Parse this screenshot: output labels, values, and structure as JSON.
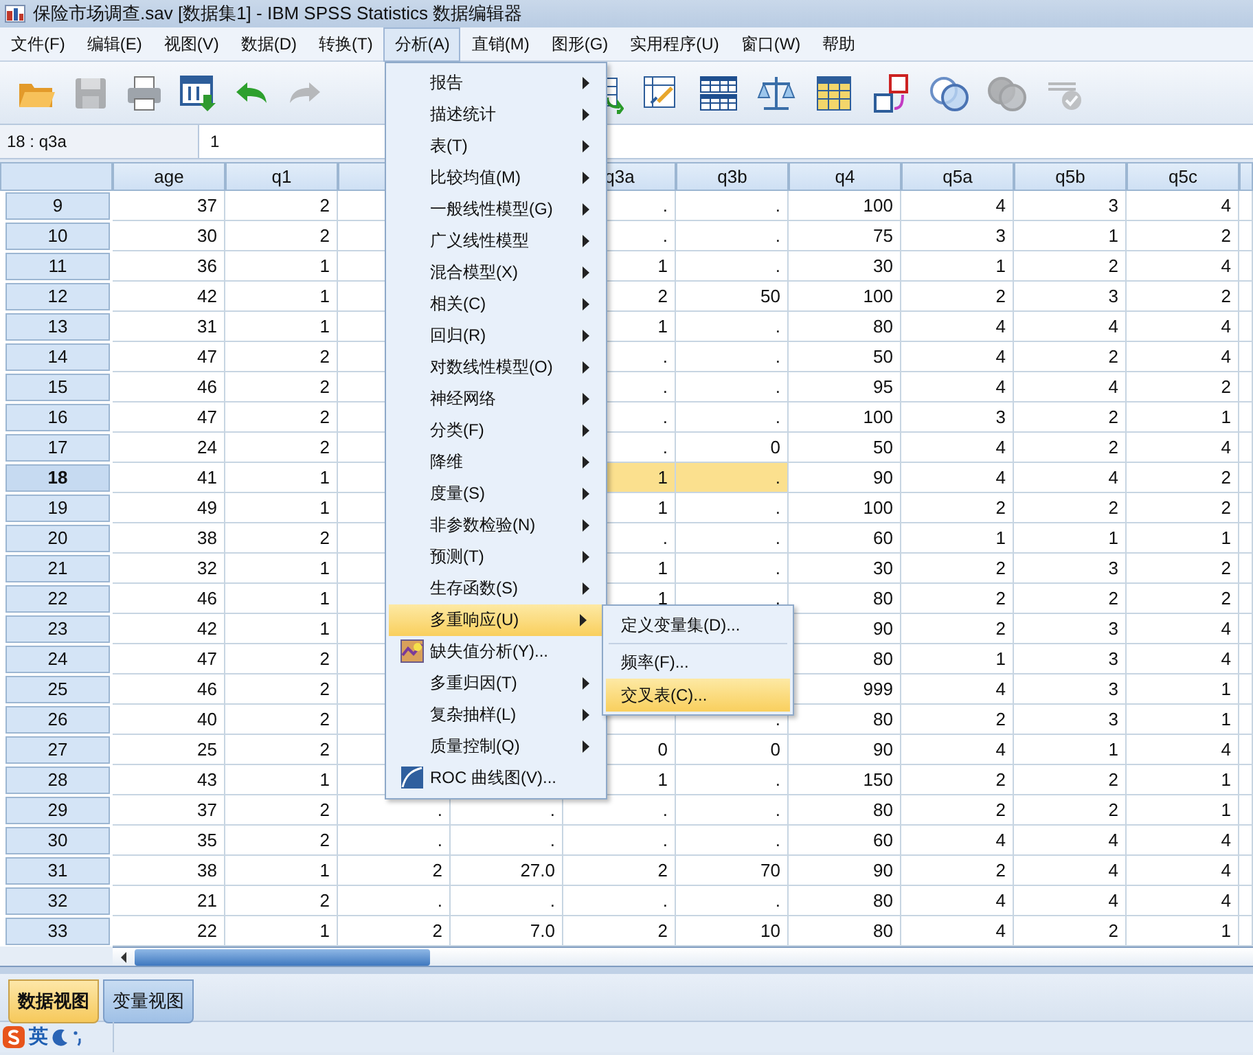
{
  "window": {
    "title": "保险市场调查.sav [数据集1] - IBM SPSS Statistics 数据编辑器"
  },
  "menu_bar": [
    {
      "label": "文件(F)",
      "selected": false
    },
    {
      "label": "编辑(E)",
      "selected": false
    },
    {
      "label": "视图(V)",
      "selected": false
    },
    {
      "label": "数据(D)",
      "selected": false
    },
    {
      "label": "转换(T)",
      "selected": false
    },
    {
      "label": "分析(A)",
      "selected": true
    },
    {
      "label": "直销(M)",
      "selected": false
    },
    {
      "label": "图形(G)",
      "selected": false
    },
    {
      "label": "实用程序(U)",
      "selected": false
    },
    {
      "label": "窗口(W)",
      "selected": false
    },
    {
      "label": "帮助",
      "selected": false
    }
  ],
  "toolbar_left": [
    {
      "kind": "open",
      "disabled": false
    },
    {
      "kind": "save",
      "disabled": true
    },
    {
      "kind": "print",
      "disabled": false
    },
    {
      "kind": "goto",
      "disabled": false
    },
    {
      "kind": "undo",
      "disabled": false
    },
    {
      "kind": "redo",
      "disabled": true
    }
  ],
  "toolbar_right": [
    {
      "kind": "insert",
      "disabled": false
    },
    {
      "kind": "select",
      "disabled": false
    },
    {
      "kind": "split",
      "disabled": false
    },
    {
      "kind": "weight",
      "disabled": false
    },
    {
      "kind": "grid",
      "disabled": false
    },
    {
      "kind": "labels",
      "disabled": false
    },
    {
      "kind": "sets",
      "disabled": false
    },
    {
      "kind": "sets",
      "disabled": true
    },
    {
      "kind": "spell",
      "disabled": true
    }
  ],
  "cell_bar": {
    "reference": "18 : q3a",
    "value": "1"
  },
  "table": {
    "columns": [
      {
        "label": "age"
      },
      {
        "label": "q1"
      },
      {},
      {},
      {
        "label": "q3a"
      },
      {
        "label": "q3b"
      },
      {
        "label": "q4"
      },
      {
        "label": "q5a"
      },
      {
        "label": "q5b"
      },
      {
        "label": "q5c"
      },
      {}
    ],
    "rows": [
      {
        "number": "9",
        "selected": false,
        "cells": [
          "37",
          "2",
          null,
          null,
          ".",
          ".",
          "100",
          "4",
          "3",
          "4"
        ]
      },
      {
        "number": "10",
        "selected": false,
        "cells": [
          "30",
          "2",
          null,
          null,
          ".",
          ".",
          "75",
          "3",
          "1",
          "2"
        ]
      },
      {
        "number": "11",
        "selected": false,
        "cells": [
          "36",
          "1",
          null,
          null,
          "1",
          ".",
          "30",
          "1",
          "2",
          "4"
        ]
      },
      {
        "number": "12",
        "selected": false,
        "cells": [
          "42",
          "1",
          null,
          null,
          "2",
          "50",
          "100",
          "2",
          "3",
          "2"
        ]
      },
      {
        "number": "13",
        "selected": false,
        "cells": [
          "31",
          "1",
          null,
          null,
          "1",
          ".",
          "80",
          "4",
          "4",
          "4"
        ]
      },
      {
        "number": "14",
        "selected": false,
        "cells": [
          "47",
          "2",
          null,
          null,
          ".",
          ".",
          "50",
          "4",
          "2",
          "4"
        ]
      },
      {
        "number": "15",
        "selected": false,
        "cells": [
          "46",
          "2",
          null,
          null,
          ".",
          ".",
          "95",
          "4",
          "4",
          "2"
        ]
      },
      {
        "number": "16",
        "selected": false,
        "cells": [
          "47",
          "2",
          null,
          null,
          ".",
          ".",
          "100",
          "3",
          "2",
          "1"
        ]
      },
      {
        "number": "17",
        "selected": false,
        "cells": [
          "24",
          "2",
          null,
          null,
          ".",
          "0",
          "50",
          "4",
          "2",
          "4"
        ]
      },
      {
        "number": "18",
        "selected": true,
        "cells": [
          {
            "text": "41",
            "selected": false
          },
          {
            "text": "1",
            "selected": false
          },
          null,
          null,
          {
            "text": "1",
            "selected": true
          },
          {
            "text": ".",
            "selected": true
          },
          {
            "text": "90",
            "selected": false
          },
          {
            "text": "4",
            "selected": false
          },
          {
            "text": "4",
            "selected": false
          },
          {
            "text": "2",
            "selected": false
          }
        ]
      },
      {
        "number": "19",
        "selected": false,
        "cells": [
          "49",
          "1",
          null,
          null,
          "1",
          ".",
          "100",
          "2",
          "2",
          "2"
        ]
      },
      {
        "number": "20",
        "selected": false,
        "cells": [
          "38",
          "2",
          null,
          null,
          ".",
          ".",
          "60",
          "1",
          "1",
          "1"
        ]
      },
      {
        "number": "21",
        "selected": false,
        "cells": [
          "32",
          "1",
          null,
          null,
          "1",
          ".",
          "30",
          "2",
          "3",
          "2"
        ]
      },
      {
        "number": "22",
        "selected": false,
        "cells": [
          "46",
          "1",
          null,
          null,
          "1",
          ".",
          "80",
          "2",
          "2",
          "2"
        ]
      },
      {
        "number": "23",
        "selected": false,
        "cells": [
          "42",
          "1",
          null,
          null,
          null,
          null,
          "90",
          "2",
          "3",
          "4"
        ]
      },
      {
        "number": "24",
        "selected": false,
        "cells": [
          "47",
          "2",
          null,
          null,
          null,
          null,
          "80",
          "1",
          "3",
          "4"
        ]
      },
      {
        "number": "25",
        "selected": false,
        "cells": [
          "46",
          "2",
          null,
          null,
          null,
          null,
          "999",
          "4",
          "3",
          "1"
        ]
      },
      {
        "number": "26",
        "selected": false,
        "cells": [
          "40",
          "2",
          null,
          null,
          null,
          ".",
          "80",
          "2",
          "3",
          "1"
        ]
      },
      {
        "number": "27",
        "selected": false,
        "cells": [
          "25",
          "2",
          null,
          null,
          "0",
          "0",
          "90",
          "4",
          "1",
          "4"
        ]
      },
      {
        "number": "28",
        "selected": false,
        "cells": [
          "43",
          "1",
          null,
          null,
          "1",
          ".",
          "150",
          "2",
          "2",
          "1"
        ]
      },
      {
        "number": "29",
        "selected": false,
        "cells": [
          "37",
          "2",
          ".",
          ".",
          ".",
          ".",
          "80",
          "2",
          "2",
          "1"
        ]
      },
      {
        "number": "30",
        "selected": false,
        "cells": [
          "35",
          "2",
          ".",
          ".",
          ".",
          ".",
          "60",
          "4",
          "4",
          "4"
        ]
      },
      {
        "number": "31",
        "selected": false,
        "cells": [
          "38",
          "1",
          "2",
          "27.0",
          "2",
          "70",
          "90",
          "2",
          "4",
          "4"
        ]
      },
      {
        "number": "32",
        "selected": false,
        "cells": [
          "21",
          "2",
          ".",
          ".",
          ".",
          ".",
          "80",
          "4",
          "4",
          "4"
        ]
      },
      {
        "number": "33",
        "selected": false,
        "cells": [
          "22",
          "1",
          "2",
          "7.0",
          "2",
          "10",
          "80",
          "4",
          "2",
          "1"
        ]
      }
    ]
  },
  "analyze_menu": [
    {
      "label": "报告",
      "submenu": true,
      "selected": false
    },
    {
      "label": "描述统计",
      "submenu": true,
      "selected": false
    },
    {
      "label": "表(T)",
      "submenu": true,
      "selected": false
    },
    {
      "label": "比较均值(M)",
      "submenu": true,
      "selected": false
    },
    {
      "label": "一般线性模型(G)",
      "submenu": true,
      "selected": false
    },
    {
      "label": "广义线性模型",
      "submenu": true,
      "selected": false
    },
    {
      "label": "混合模型(X)",
      "submenu": true,
      "selected": false
    },
    {
      "label": "相关(C)",
      "submenu": true,
      "selected": false
    },
    {
      "label": "回归(R)",
      "submenu": true,
      "selected": false
    },
    {
      "label": "对数线性模型(O)",
      "submenu": true,
      "selected": false
    },
    {
      "label": "神经网络",
      "submenu": true,
      "selected": false
    },
    {
      "label": "分类(F)",
      "submenu": true,
      "selected": false
    },
    {
      "label": "降维",
      "submenu": true,
      "selected": false
    },
    {
      "label": "度量(S)",
      "submenu": true,
      "selected": false
    },
    {
      "label": "非参数检验(N)",
      "submenu": true,
      "selected": false
    },
    {
      "label": "预测(T)",
      "submenu": true,
      "selected": false
    },
    {
      "label": "生存函数(S)",
      "submenu": true,
      "selected": false
    },
    {
      "label": "多重响应(U)",
      "submenu": true,
      "selected": true
    },
    {
      "label": "缺失值分析(Y)...",
      "submenu": false,
      "selected": false
    },
    {
      "label": "多重归因(T)",
      "submenu": true,
      "selected": false
    },
    {
      "label": "复杂抽样(L)",
      "submenu": true,
      "selected": false
    },
    {
      "label": "质量控制(Q)",
      "submenu": true,
      "selected": false
    },
    {
      "label": "ROC 曲线图(V)...",
      "submenu": false,
      "selected": false
    }
  ],
  "submenu": [
    {
      "label": "定义变量集(D)...",
      "selected": false
    },
    {
      "label": "频率(F)...",
      "selected": false
    },
    {
      "label": "交叉表(C)...",
      "selected": true
    }
  ],
  "view_tabs": [
    {
      "label": "数据视图",
      "selected": true
    },
    {
      "label": "变量视图",
      "selected": false
    }
  ],
  "status_bar": {
    "ime_label": "英"
  }
}
